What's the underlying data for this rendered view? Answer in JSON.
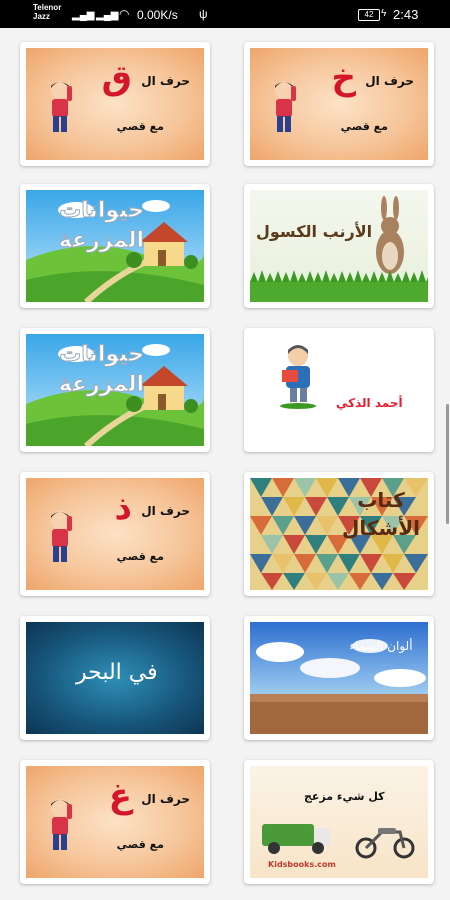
{
  "status_bar": {
    "carrier_line1": "Telenor",
    "carrier_line2": "Jazz",
    "speed": "0.00K/s",
    "battery": "42",
    "time": "2:43"
  },
  "cards": [
    {
      "id": "qaf",
      "kind": "letter",
      "title": "حرف ال",
      "letter": "ق",
      "subtitle": "مع قصي"
    },
    {
      "id": "kha",
      "kind": "letter",
      "title": "حرف ال",
      "letter": "خ",
      "subtitle": "مع قصي"
    },
    {
      "id": "farm1",
      "kind": "farm",
      "title": "حيوانات المزرعة"
    },
    {
      "id": "rabbit",
      "kind": "rabbit",
      "title": "الأرنب الكسول"
    },
    {
      "id": "farm2",
      "kind": "farm",
      "title": "حيوانات المزرعة"
    },
    {
      "id": "ahmed",
      "kind": "ahmed",
      "title": "أحمد الذكي"
    },
    {
      "id": "thal",
      "kind": "letter",
      "title": "حرف ال",
      "letter": "ذ",
      "subtitle": "مع قصي"
    },
    {
      "id": "shapes",
      "kind": "shapes",
      "title": "كتاب الأشكال"
    },
    {
      "id": "sea",
      "kind": "sea",
      "title": "في البحر"
    },
    {
      "id": "sky",
      "kind": "sky",
      "title": "ألوان السماء"
    },
    {
      "id": "ghain",
      "kind": "letter",
      "title": "حرف ال",
      "letter": "غ",
      "subtitle": "مع قصي"
    },
    {
      "id": "noisy",
      "kind": "noisy",
      "title": "كل شيء مزعج",
      "logo": "Kidsbooks.com"
    }
  ]
}
